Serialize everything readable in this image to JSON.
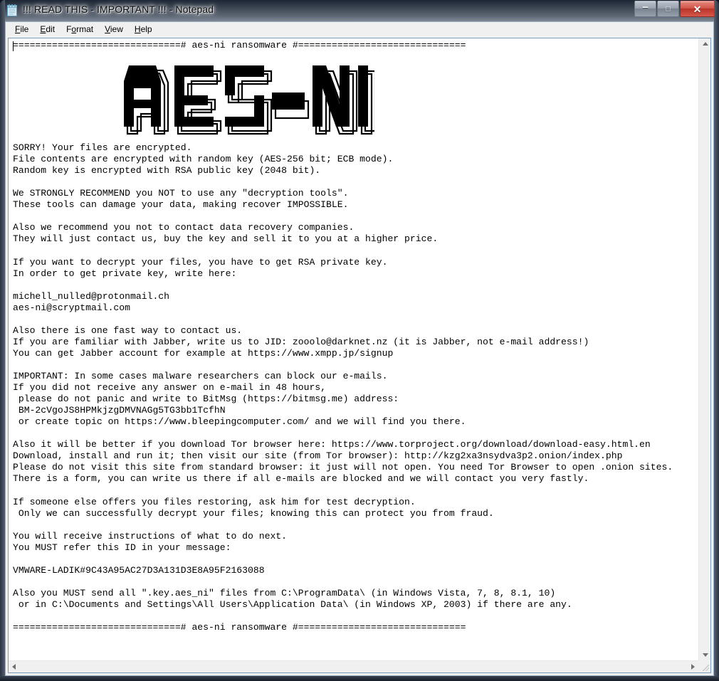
{
  "window": {
    "title": "!!! READ THIS - IMPORTANT !!! - Notepad",
    "icon": "notepad-icon",
    "controls": {
      "minimize": "–",
      "maximize": "□",
      "close": "✕"
    }
  },
  "menu": {
    "items": [
      {
        "label": "File",
        "accel": "F"
      },
      {
        "label": "Edit",
        "accel": "E"
      },
      {
        "label": "Format",
        "accel": "o"
      },
      {
        "label": "View",
        "accel": "V"
      },
      {
        "label": "Help",
        "accel": "H"
      }
    ]
  },
  "document": {
    "header_rule": "==============================# aes-ni ransomware #==============================",
    "footer_rule": "==============================# aes-ni ransomware #==============================",
    "logo_alt": "AES-NI",
    "body": "SORRY! Your files are encrypted.\nFile contents are encrypted with random key (AES-256 bit; ECB mode).\nRandom key is encrypted with RSA public key (2048 bit).\n\nWe STRONGLY RECOMMEND you NOT to use any \"decryption tools\".\nThese tools can damage your data, making recover IMPOSSIBLE.\n\nAlso we recommend you not to contact data recovery companies.\nThey will just contact us, buy the key and sell it to you at a higher price.\n\nIf you want to decrypt your files, you have to get RSA private key.\nIn order to get private key, write here:\n\nmichell_nulled@protonmail.ch\naes-ni@scryptmail.com\n\nAlso there is one fast way to contact us.\nIf you are familiar with Jabber, write us to JID: zooolo@darknet.nz (it is Jabber, not e-mail address!)\nYou can get Jabber account for example at https://www.xmpp.jp/signup\n\nIMPORTANT: In some cases malware researchers can block our e-mails.\nIf you did not receive any answer on e-mail in 48 hours,\n please do not panic and write to BitMsg (https://bitmsg.me) address:\n BM-2cVgoJS8HPMkjzgDMVNAGg5TG3bb1TcfhN\n or create topic on https://www.bleepingcomputer.com/ and we will find you there.\n\nAlso it will be better if you download Tor browser here: https://www.torproject.org/download/download-easy.html.en\nDownload, install and run it; then visit our site (from Tor browser): http://kzg2xa3nsydva3p2.onion/index.php\nPlease do not visit this site from standard browser: it just will not open. You need Tor Browser to open .onion sites.\nThere is a form, you can write us there if all e-mails are blocked and we will contact you very fastly.\n\nIf someone else offers you files restoring, ask him for test decryption.\n Only we can successfully decrypt your files; knowing this can protect you from fraud.\n\nYou will receive instructions of what to do next.\nYou MUST refer this ID in your message:\n\nVMWARE-LADIK#9C43A95AC27D3A131D3E8A95F2163088\n\nAlso you MUST send all \".key.aes_ni\" files from C:\\ProgramData\\ (in Windows Vista, 7, 8, 8.1, 10)\n or in C:\\Documents and Settings\\All Users\\Application Data\\ (in Windows XP, 2003) if there are any.\n\n",
    "contacts": {
      "email_1": "michell_nulled@protonmail.ch",
      "email_2": "aes-ni@scryptmail.com",
      "jabber_jid": "zooolo@darknet.nz",
      "jabber_signup": "https://www.xmpp.jp/signup",
      "bitmsg_site": "https://bitmsg.me",
      "bitmsg_address": "BM-2cVgoJS8HPMkjzgDMVNAGg5TG3bb1TcfhN",
      "forum": "https://www.bleepingcomputer.com/",
      "tor_download": "https://www.torproject.org/download/download-easy.html.en",
      "onion_site": "http://kzg2xa3nsydva3p2.onion/index.php"
    },
    "victim_id": "VMWARE-LADIK#9C43A95AC27D3A131D3E8A95F2163088",
    "crypto": {
      "file_cipher": "AES-256 bit; ECB mode",
      "key_cipher": "RSA public key (2048 bit)",
      "response_window_hours": "48",
      "key_file_extension": ".key.aes_ni"
    }
  },
  "scrollbars": {
    "vertical": {
      "up": "scroll-up-arrow",
      "down": "scroll-down-arrow"
    },
    "horizontal": {
      "left": "scroll-left-arrow",
      "right": "scroll-right-arrow"
    }
  },
  "colors": {
    "close_button": "#c0392b",
    "editor_background": "#ffffff",
    "text": "#000000",
    "chrome": "#f0f0f0"
  }
}
